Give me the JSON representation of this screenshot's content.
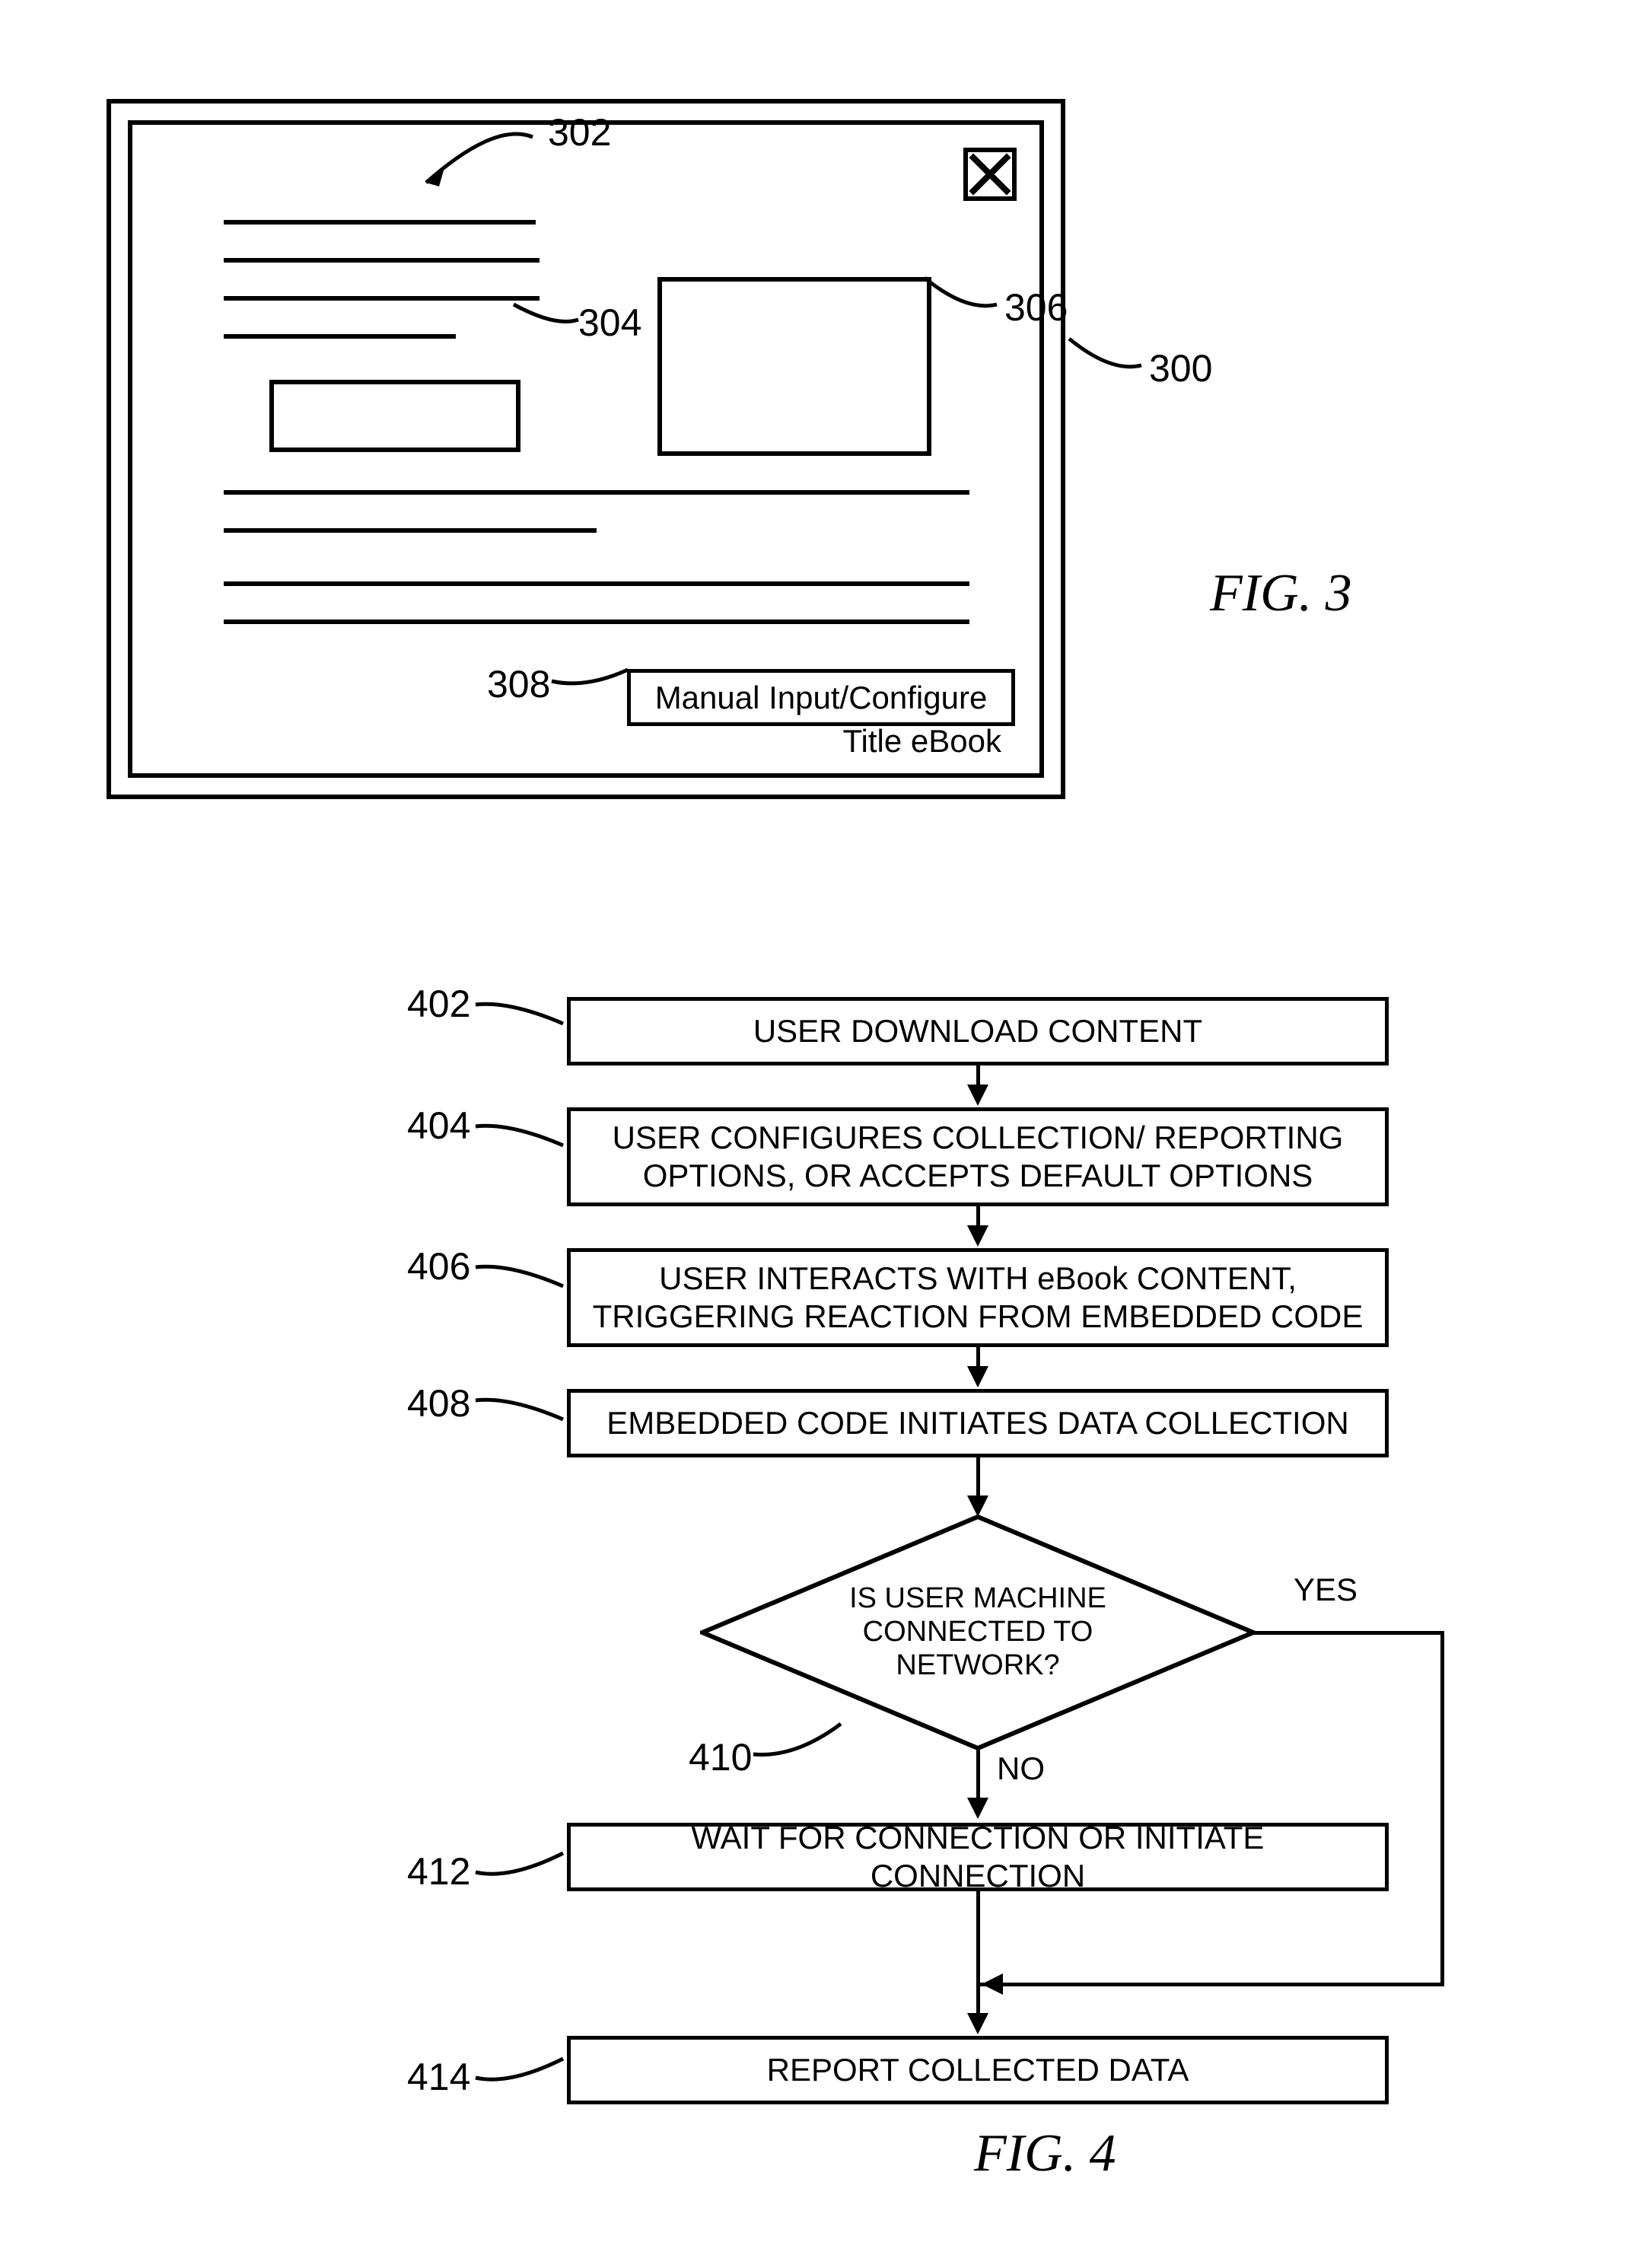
{
  "fig3": {
    "refs": {
      "r300": "300",
      "r302": "302",
      "r304": "304",
      "r306": "306",
      "r308": "308"
    },
    "button_label": "Manual Input/Configure",
    "footer_title": "Title eBook",
    "caption": "FIG. 3"
  },
  "fig4": {
    "refs": {
      "r402": "402",
      "r404": "404",
      "r406": "406",
      "r408": "408",
      "r410": "410",
      "r412": "412",
      "r414": "414"
    },
    "steps": {
      "s402": "USER DOWNLOAD CONTENT",
      "s404": "USER CONFIGURES COLLECTION/ REPORTING OPTIONS, OR ACCEPTS DEFAULT OPTIONS",
      "s406": "USER INTERACTS WITH eBook CONTENT, TRIGGERING REACTION FROM EMBEDDED CODE",
      "s408": "EMBEDDED CODE INITIATES DATA COLLECTION",
      "s410": "IS USER MACHINE CONNECTED TO NETWORK?",
      "s412": "WAIT FOR CONNECTION OR INITIATE CONNECTION",
      "s414": "REPORT COLLECTED DATA"
    },
    "yes_label": "YES",
    "no_label": "NO",
    "caption": "FIG. 4"
  }
}
